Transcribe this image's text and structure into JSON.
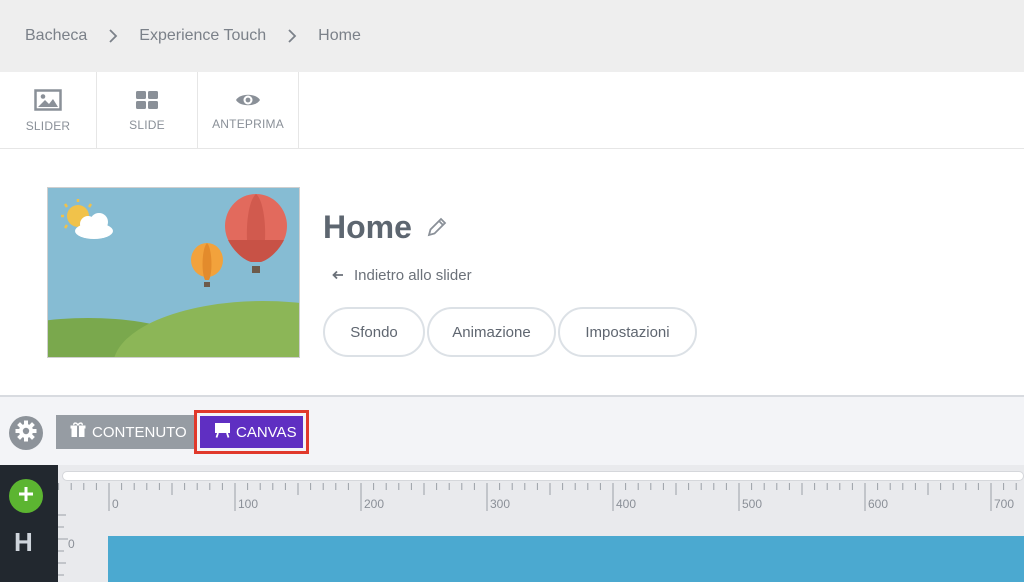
{
  "breadcrumb": {
    "items": [
      "Bacheca",
      "Experience Touch",
      "Home"
    ]
  },
  "toolbar": {
    "items": [
      {
        "label": "SLIDER",
        "icon": "image-icon"
      },
      {
        "label": "SLIDE",
        "icon": "grid-icon"
      },
      {
        "label": "ANTEPRIMA",
        "icon": "eye-icon"
      }
    ]
  },
  "header": {
    "title": "Home",
    "back_label": "Indietro allo slider",
    "pills": [
      "Sfondo",
      "Animazione",
      "Impostazioni"
    ]
  },
  "modebar": {
    "contenuto_label": "CONTENUTO",
    "canvas_label": "CANVAS"
  },
  "editor": {
    "rail_letter": "H",
    "ruler_labels": [
      "0",
      "100",
      "200",
      "300",
      "400",
      "500",
      "600",
      "700"
    ],
    "vertical_label": "0"
  },
  "colors": {
    "accent": "#5f2fc2",
    "highlight": "#e0392b",
    "add": "#5cb531",
    "stage": "#4ba9d0"
  }
}
